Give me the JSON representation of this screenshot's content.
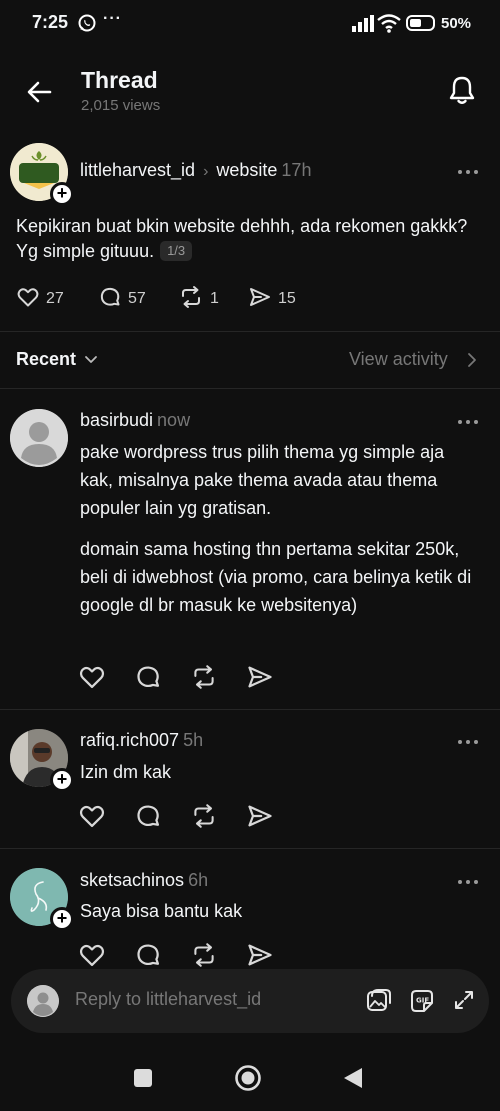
{
  "status_bar": {
    "time": "7:25",
    "overflow_dots": "···",
    "battery_pct": "50%",
    "battery_level": 0.5
  },
  "header": {
    "title": "Thread",
    "views": "2,015 views"
  },
  "post": {
    "author": "littleharvest_id",
    "avatar_text": "LITTLE HARVEST",
    "community": "website",
    "time": "17h",
    "text": "Kepikiran buat bkin website dehhh, ada rekomen gakkk? Yg simple gituuu.",
    "page_indicator": "1/3",
    "likes": "27",
    "replies": "57",
    "reposts": "1",
    "shares": "15"
  },
  "recent_bar": {
    "sort_label": "Recent",
    "activity_label": "View activity"
  },
  "replies": [
    {
      "author": "basirbudi",
      "time": "now",
      "paragraphs": [
        "pake wordpress trus pilih thema yg simple aja kak, misalnya pake thema avada atau thema populer lain yg gratisan.",
        "domain sama hosting thn pertama sekitar 250k, beli di idwebhost (via promo, cara belinya ketik di google dl br masuk ke websitenya)"
      ]
    },
    {
      "author": "rafiq.rich007",
      "time": "5h",
      "paragraphs": [
        "Izin dm kak"
      ]
    },
    {
      "author": "sketsachinos",
      "time": "6h",
      "paragraphs": [
        "Saya bisa bantu kak"
      ]
    }
  ],
  "composer": {
    "placeholder": "Reply to littleharvest_id",
    "gif_label": "GIF"
  },
  "colors": {
    "background": "#101010",
    "text": "#f3f5f7",
    "muted": "#777777",
    "divider": "#262626"
  }
}
